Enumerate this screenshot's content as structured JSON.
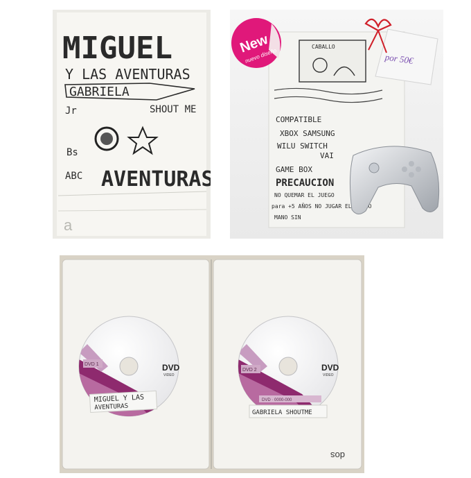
{
  "cover": {
    "title_line1": "MIGUEL",
    "title_line2": "Y LAS AVENTURAS",
    "title_line3": "GABRIELA",
    "subtitle": "SHOUT ME",
    "word_big": "AVENTURAS",
    "corner_mark": "a",
    "small_marks": [
      "Jr",
      "Bs",
      "ABC"
    ]
  },
  "back": {
    "badge_word": "New",
    "badge_sub": "nuevo diseño",
    "price_tag": "por 50€",
    "mini_label": "CABALLO",
    "lines": [
      "COMPATIBLE",
      "XBOX SAMSUNG",
      "WILU SWITCH",
      "VAI",
      "GAME BOX",
      "PRECAUCION",
      "NO QUEMAR EL JUEGO",
      "para +5 AÑOS NO JUGAR EL JUEGO",
      "MANO SIN"
    ]
  },
  "discs": {
    "left": {
      "number": "1",
      "chip_text": "DVD 1",
      "logo": "DVD",
      "logo_sub": "VIDEO",
      "label_line1": "MIGUEL Y LAS",
      "label_line2": "AVENTURAS"
    },
    "right": {
      "number": "2",
      "chip_text": "DVD 2",
      "logo": "DVD",
      "logo_sub": "VIDEO",
      "strip_text": "DVD · 0000-000",
      "label_line1": "GABRIELA SHOUTME"
    },
    "case_mark": "dos"
  },
  "colors": {
    "paper": "#f2f2f0",
    "case": "#f4f3ef",
    "disc_purple": "#8e2a6e",
    "badge_pink": "#e0187a",
    "ribbon": "#d0202a",
    "price_text": "#7a4fb0"
  }
}
